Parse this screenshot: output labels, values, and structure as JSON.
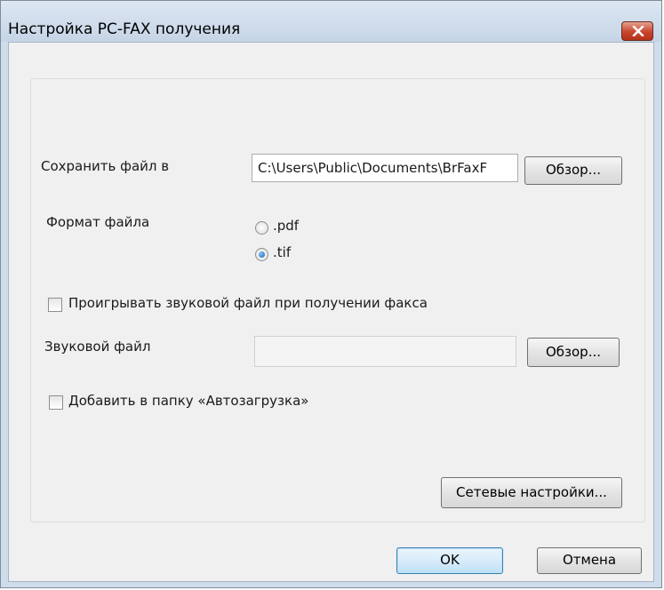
{
  "window": {
    "title": "Настройка PC-FAX получения"
  },
  "save": {
    "label": "Сохранить файл в",
    "path_value": "C:\\Users\\Public\\Documents\\BrFaxF",
    "browse_label": "Обзор..."
  },
  "format": {
    "label": "Формат файла",
    "options": [
      {
        "label": ".pdf",
        "checked": false
      },
      {
        "label": ".tif",
        "checked": true
      }
    ]
  },
  "sound": {
    "checkbox_label": "Проигрывать звуковой файл при получении факса",
    "checked": false,
    "file_label": "Звуковой файл",
    "file_value": "",
    "browse_label": "Обзор..."
  },
  "startup": {
    "checkbox_label": "Добавить в папку «Автозагрузка»",
    "checked": false
  },
  "network_settings_label": "Сетевые настройки...",
  "footer": {
    "ok_label": "OK",
    "cancel_label": "Отмена"
  },
  "colors": {
    "title_bar": "#c5d4e6",
    "dialog_bg": "#f0f0f0",
    "close_button": "#c8452d",
    "default_button_border": "#3c7fb1"
  }
}
